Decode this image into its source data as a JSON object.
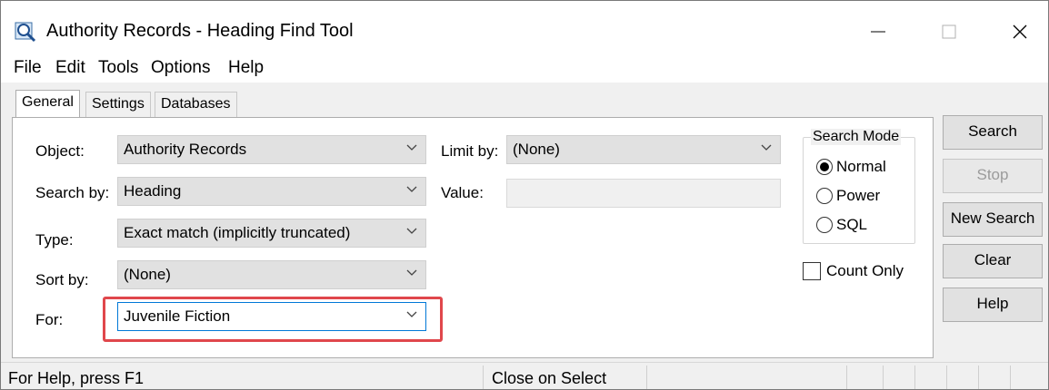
{
  "window": {
    "title": "Authority Records - Heading Find Tool",
    "controls": {
      "minimize": "—",
      "maximize": "☐",
      "close": "✕"
    }
  },
  "menu": [
    "File",
    "Edit",
    "Tools",
    "Options",
    "Help"
  ],
  "tabs": [
    {
      "label": "General",
      "active": true
    },
    {
      "label": "Settings",
      "active": false
    },
    {
      "label": "Databases",
      "active": false
    }
  ],
  "form": {
    "object": {
      "label": "Object:",
      "value": "Authority Records"
    },
    "search_by": {
      "label": "Search by:",
      "value": "Heading"
    },
    "type": {
      "label": "Type:",
      "value": "Exact match (implicitly truncated)"
    },
    "sort_by": {
      "label": "Sort by:",
      "value": "(None)"
    },
    "for": {
      "label": "For:",
      "value": "Juvenile Fiction"
    },
    "limit_by": {
      "label": "Limit by:",
      "value": "(None)"
    },
    "value": {
      "label": "Value:",
      "value": ""
    }
  },
  "search_mode": {
    "title": "Search Mode",
    "options": [
      {
        "label": "Normal",
        "selected": true
      },
      {
        "label": "Power",
        "selected": false
      },
      {
        "label": "SQL",
        "selected": false
      }
    ]
  },
  "count_only": {
    "label": "Count Only",
    "checked": false
  },
  "buttons": {
    "search": "Search",
    "stop": "Stop",
    "new_search": "New Search",
    "clear": "Clear",
    "help": "Help"
  },
  "status": {
    "help_text": "For Help, press F1",
    "close_on_select": "Close on Select"
  },
  "colors": {
    "highlight": "#e0474c",
    "focus": "#0078d7"
  }
}
